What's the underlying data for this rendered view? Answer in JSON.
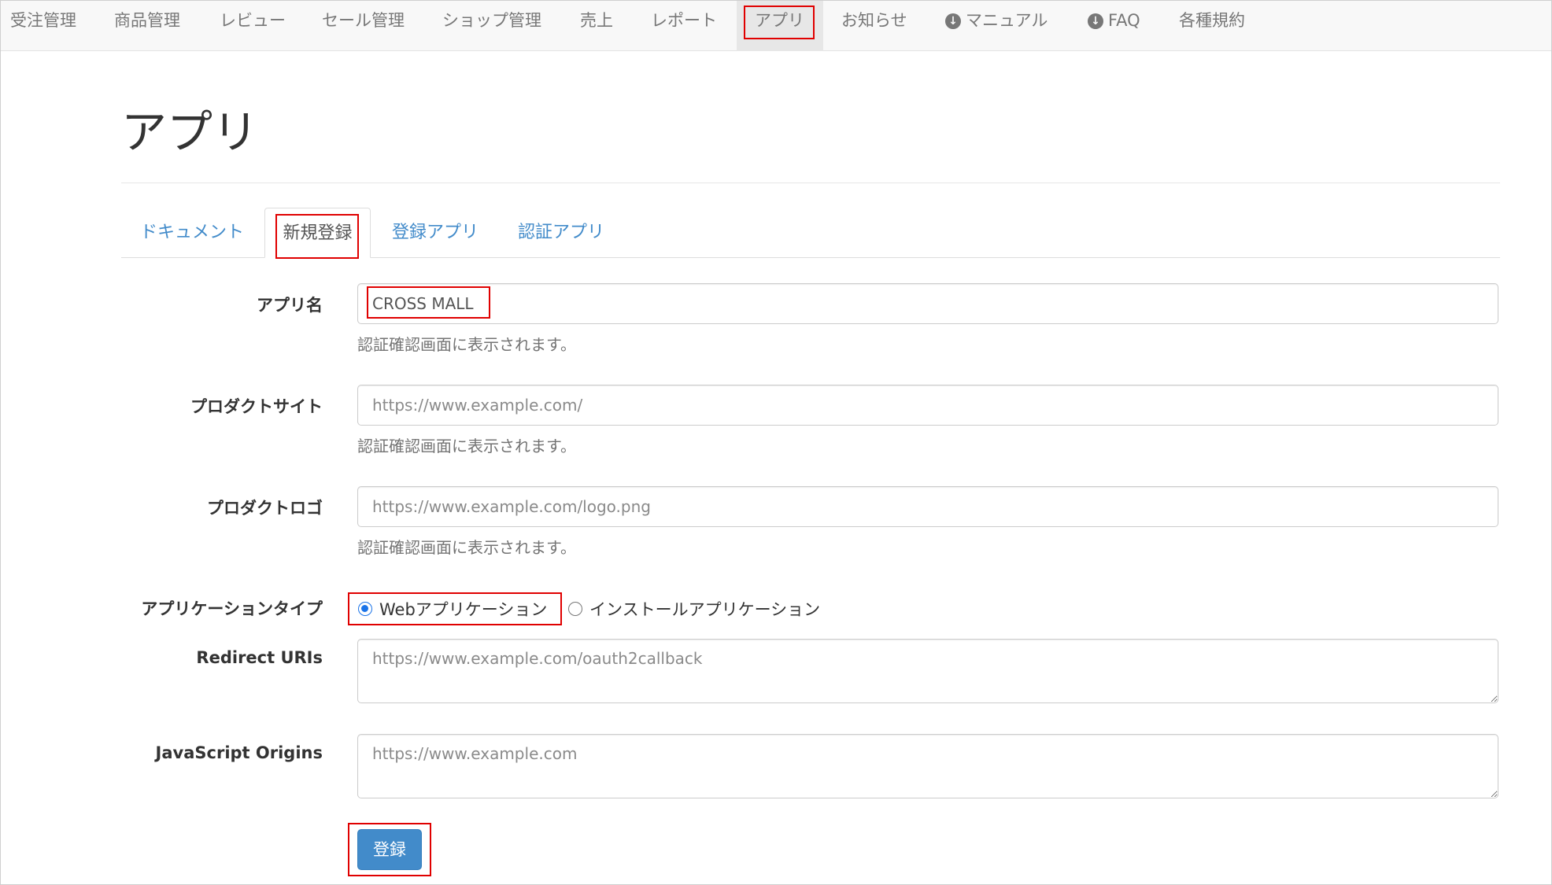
{
  "nav": {
    "items": [
      {
        "label": "受注管理"
      },
      {
        "label": "商品管理"
      },
      {
        "label": "レビュー"
      },
      {
        "label": "セール管理"
      },
      {
        "label": "ショップ管理"
      },
      {
        "label": "売上"
      },
      {
        "label": "レポート"
      },
      {
        "label": "アプリ",
        "active": true
      },
      {
        "label": "お知らせ"
      },
      {
        "label": "マニュアル",
        "icon": "download-circle-icon"
      },
      {
        "label": "FAQ",
        "icon": "download-circle-icon"
      },
      {
        "label": "各種規約"
      }
    ]
  },
  "page": {
    "title": "アプリ"
  },
  "tabs": [
    {
      "label": "ドキュメント"
    },
    {
      "label": "新規登録",
      "active": true
    },
    {
      "label": "登録アプリ"
    },
    {
      "label": "認証アプリ"
    }
  ],
  "form": {
    "app_name": {
      "label": "アプリ名",
      "value": "CROSS MALL",
      "help": "認証確認画面に表示されます。"
    },
    "product_site": {
      "label": "プロダクトサイト",
      "placeholder": "https://www.example.com/",
      "help": "認証確認画面に表示されます。"
    },
    "product_logo": {
      "label": "プロダクトロゴ",
      "placeholder": "https://www.example.com/logo.png",
      "help": "認証確認画面に表示されます。"
    },
    "app_type": {
      "label": "アプリケーションタイプ",
      "options": [
        {
          "label": "Webアプリケーション",
          "checked": true
        },
        {
          "label": "インストールアプリケーション",
          "checked": false
        }
      ]
    },
    "redirect_uris": {
      "label": "Redirect URIs",
      "placeholder": "https://www.example.com/oauth2callback"
    },
    "js_origins": {
      "label": "JavaScript Origins",
      "placeholder": "https://www.example.com"
    },
    "submit_label": "登録"
  },
  "colors": {
    "highlight": "#e00000",
    "link": "#428bca",
    "primary_button": "#428bca",
    "radio_checked": "#1a73e8"
  }
}
